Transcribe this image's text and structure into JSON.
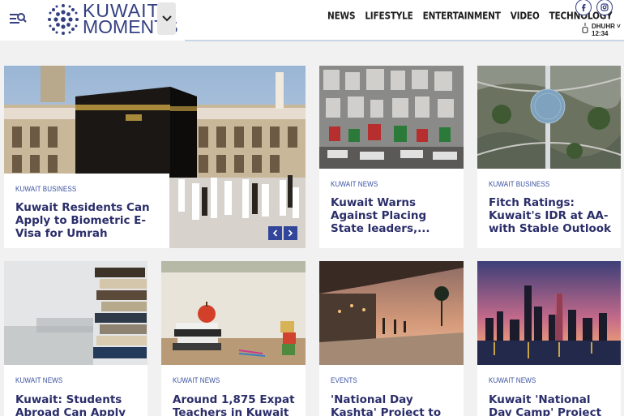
{
  "brand": {
    "line1": "KUWAIT",
    "line2": "MOMENTS",
    "color": "#343f82"
  },
  "nav": {
    "items": [
      {
        "label": "NEWS"
      },
      {
        "label": "LIFESTYLE"
      },
      {
        "label": "ENTERTAINMENT"
      },
      {
        "label": "VIDEO"
      },
      {
        "label": "TECHNOLOGY"
      }
    ]
  },
  "social": {
    "facebook": "facebook-icon",
    "instagram": "instagram-icon"
  },
  "prayer": {
    "name": "DHUHR",
    "time": "12:34"
  },
  "featured": {
    "category": "KUWAIT BUSINESS",
    "title": "Kuwait Residents Can Apply to Biometric E-Visa for Umrah"
  },
  "cards": [
    {
      "category": "KUWAIT NEWS",
      "title": "Kuwait Warns Against Placing State leaders,..."
    },
    {
      "category": "KUWAIT BUSINESS",
      "title": "Fitch Ratings: Kuwait's IDR at AA- with Stable Outlook"
    },
    {
      "category": "KUWAIT NEWS",
      "title": "Kuwait: Students Abroad Can Apply to"
    },
    {
      "category": "KUWAIT NEWS",
      "title": "Around 1,875 Expat Teachers in Kuwait"
    },
    {
      "category": "EVENTS",
      "title": "'National Day Kashta' Project to Be"
    },
    {
      "category": "KUWAIT NEWS",
      "title": "Kuwait 'National Day Camp' Project"
    }
  ],
  "colors": {
    "accent": "#31459a",
    "title": "#2b2e6a",
    "category": "#3a52a0"
  }
}
